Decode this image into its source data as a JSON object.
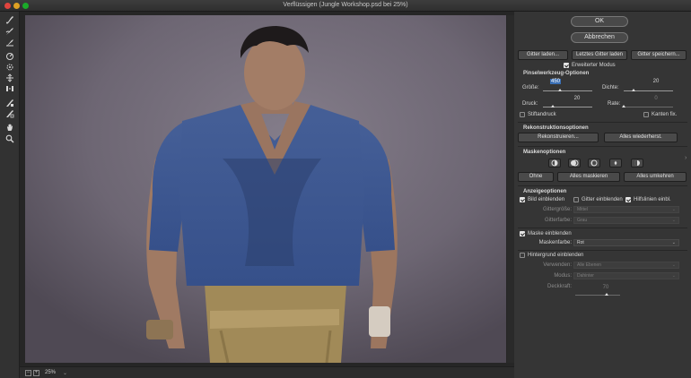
{
  "window": {
    "title": "Verflüssigen (Jungle Workshop.psd bei 25%)"
  },
  "statusbar": {
    "zoom": "25%",
    "minus": "−",
    "plus": "+",
    "zoom_arrow": "⌄"
  },
  "dialog": {
    "ok": "OK",
    "cancel": "Abbrechen"
  },
  "mesh": {
    "load": "Gitter laden...",
    "load_last": "Letztes Gitter laden",
    "save": "Gitter speichern..."
  },
  "advanced_mode": {
    "label": "Erweiterter Modus",
    "checked": true
  },
  "brush": {
    "heading": "Pinselwerkzeug-Optionen",
    "size": {
      "label": "Größe:",
      "value": "450",
      "fraction": 0.35
    },
    "density": {
      "label": "Dichte:",
      "value": "20",
      "fraction": 0.2
    },
    "pressure": {
      "label": "Druck:",
      "value": "20",
      "fraction": 0.2
    },
    "rate": {
      "label": "Rate:",
      "value": "0",
      "fraction": 0.0
    },
    "stylus": {
      "label": "Stiftandruck",
      "checked": false
    },
    "pin_edges": {
      "label": "Kanten fix.",
      "checked": false
    }
  },
  "reconstruct": {
    "heading": "Rekonstruktionsoptionen",
    "reconstruct": "Rekonstruieren...",
    "restore_all": "Alles wiederherst."
  },
  "mask": {
    "heading": "Maskenoptionen",
    "none": "Ohne",
    "mask_all": "Alles maskieren",
    "invert_all": "Alles umkehren"
  },
  "view": {
    "heading": "Anzeigeoptionen",
    "show_image": {
      "label": "Bild einblenden",
      "checked": true
    },
    "show_mesh": {
      "label": "Gitter einblenden",
      "checked": false
    },
    "show_guides": {
      "label": "Hilfslinien einbl.",
      "checked": true
    },
    "mesh_size": {
      "label": "Gittergröße:",
      "value": "Mittel"
    },
    "mesh_color": {
      "label": "Gitterfarbe:",
      "value": "Grau"
    },
    "show_mask": {
      "label": "Maske einblenden",
      "checked": true
    },
    "mask_color": {
      "label": "Maskenfarbe:",
      "value": "Rot"
    },
    "show_backdrop": {
      "label": "Hintergrund einblenden",
      "checked": false
    },
    "use": {
      "label": "Verwenden:",
      "value": "Alle Ebenen"
    },
    "mode": {
      "label": "Modus:",
      "value": "Dahinter"
    },
    "opacity": {
      "label": "Deckkraft:",
      "value": "70",
      "fraction": 0.7
    }
  },
  "icons": {
    "tools": [
      "forward-warp-icon",
      "reconstruct-icon",
      "smooth-icon",
      "twirl-clockwise-icon",
      "pucker-icon",
      "bloat-icon",
      "push-left-icon",
      "freeze-mask-icon",
      "thaw-mask-icon",
      "hand-icon",
      "zoom-icon"
    ]
  },
  "colors": {
    "panel": "#353535",
    "toolbar": "#323232",
    "photo_bg": "#6f6875",
    "shirt": "#3f5a92",
    "pants": "#a18a58",
    "highlight": "#3a6fb5"
  }
}
